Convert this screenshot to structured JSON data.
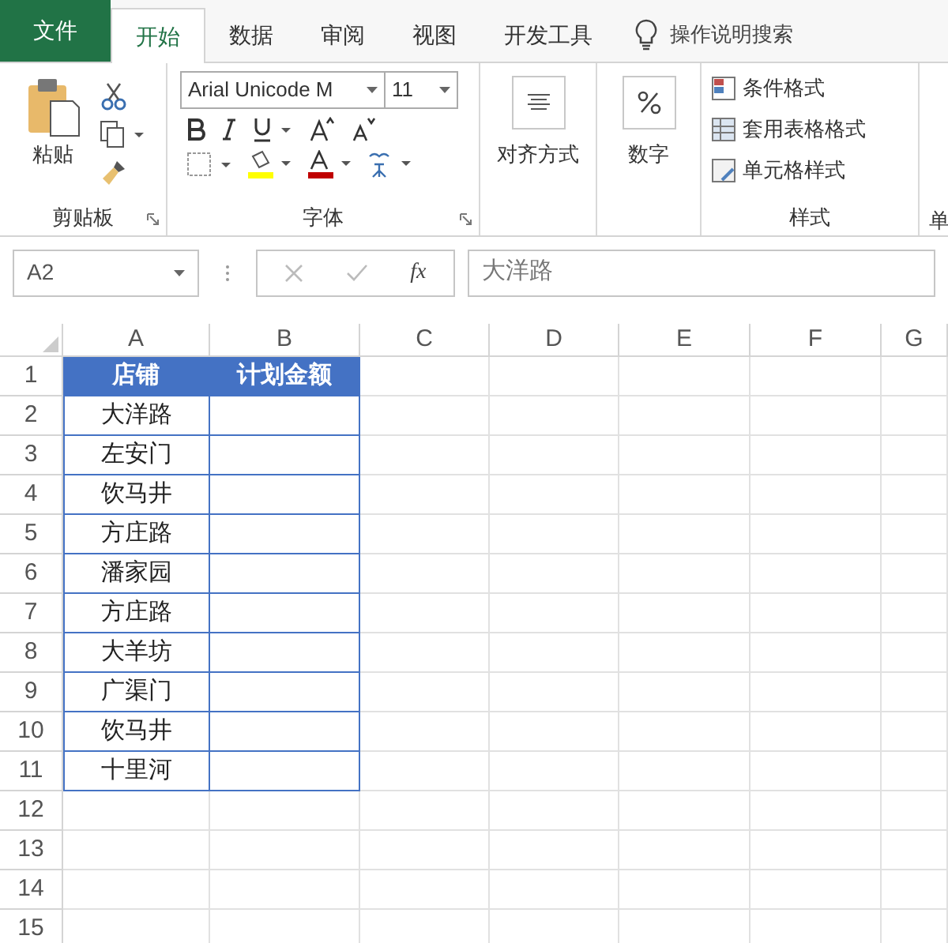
{
  "tabs": [
    {
      "label": "文件",
      "kind": "file",
      "selected": false
    },
    {
      "label": "开始",
      "kind": "tab",
      "selected": true
    },
    {
      "label": "数据",
      "kind": "tab",
      "selected": false
    },
    {
      "label": "审阅",
      "kind": "tab",
      "selected": false
    },
    {
      "label": "视图",
      "kind": "tab",
      "selected": false
    },
    {
      "label": "开发工具",
      "kind": "tab",
      "selected": false
    }
  ],
  "tell_me": {
    "placeholder": "操作说明搜索"
  },
  "ribbon": {
    "clipboard": {
      "paste_label": "粘贴",
      "group_label": "剪贴板"
    },
    "font": {
      "font_name": "Arial Unicode M",
      "font_size": "11",
      "group_label": "字体"
    },
    "alignment": {
      "label": "对齐方式"
    },
    "number": {
      "label": "数字"
    },
    "styles": {
      "items": [
        "条件格式",
        "套用表格格式",
        "单元格样式"
      ],
      "group_label": "样式"
    },
    "group_6": {
      "label": "单"
    }
  },
  "formula_bar": {
    "name_box": "A2",
    "fx": "fx",
    "value": "大洋路"
  },
  "sheet": {
    "columns": [
      "A",
      "B",
      "C",
      "D",
      "E",
      "F",
      "G"
    ],
    "rows": [
      "1",
      "2",
      "3",
      "4",
      "5",
      "6",
      "7",
      "8",
      "9",
      "10",
      "11",
      "12",
      "13",
      "14",
      "15"
    ],
    "table": {
      "header": [
        "店铺",
        "计划金额"
      ],
      "rows": [
        [
          "大洋路",
          ""
        ],
        [
          "左安门",
          ""
        ],
        [
          "饮马井",
          ""
        ],
        [
          "方庄路",
          ""
        ],
        [
          "潘家园",
          ""
        ],
        [
          "方庄路",
          ""
        ],
        [
          "大羊坊",
          ""
        ],
        [
          "广渠门",
          ""
        ],
        [
          "饮马井",
          ""
        ],
        [
          "十里河",
          ""
        ]
      ]
    }
  }
}
